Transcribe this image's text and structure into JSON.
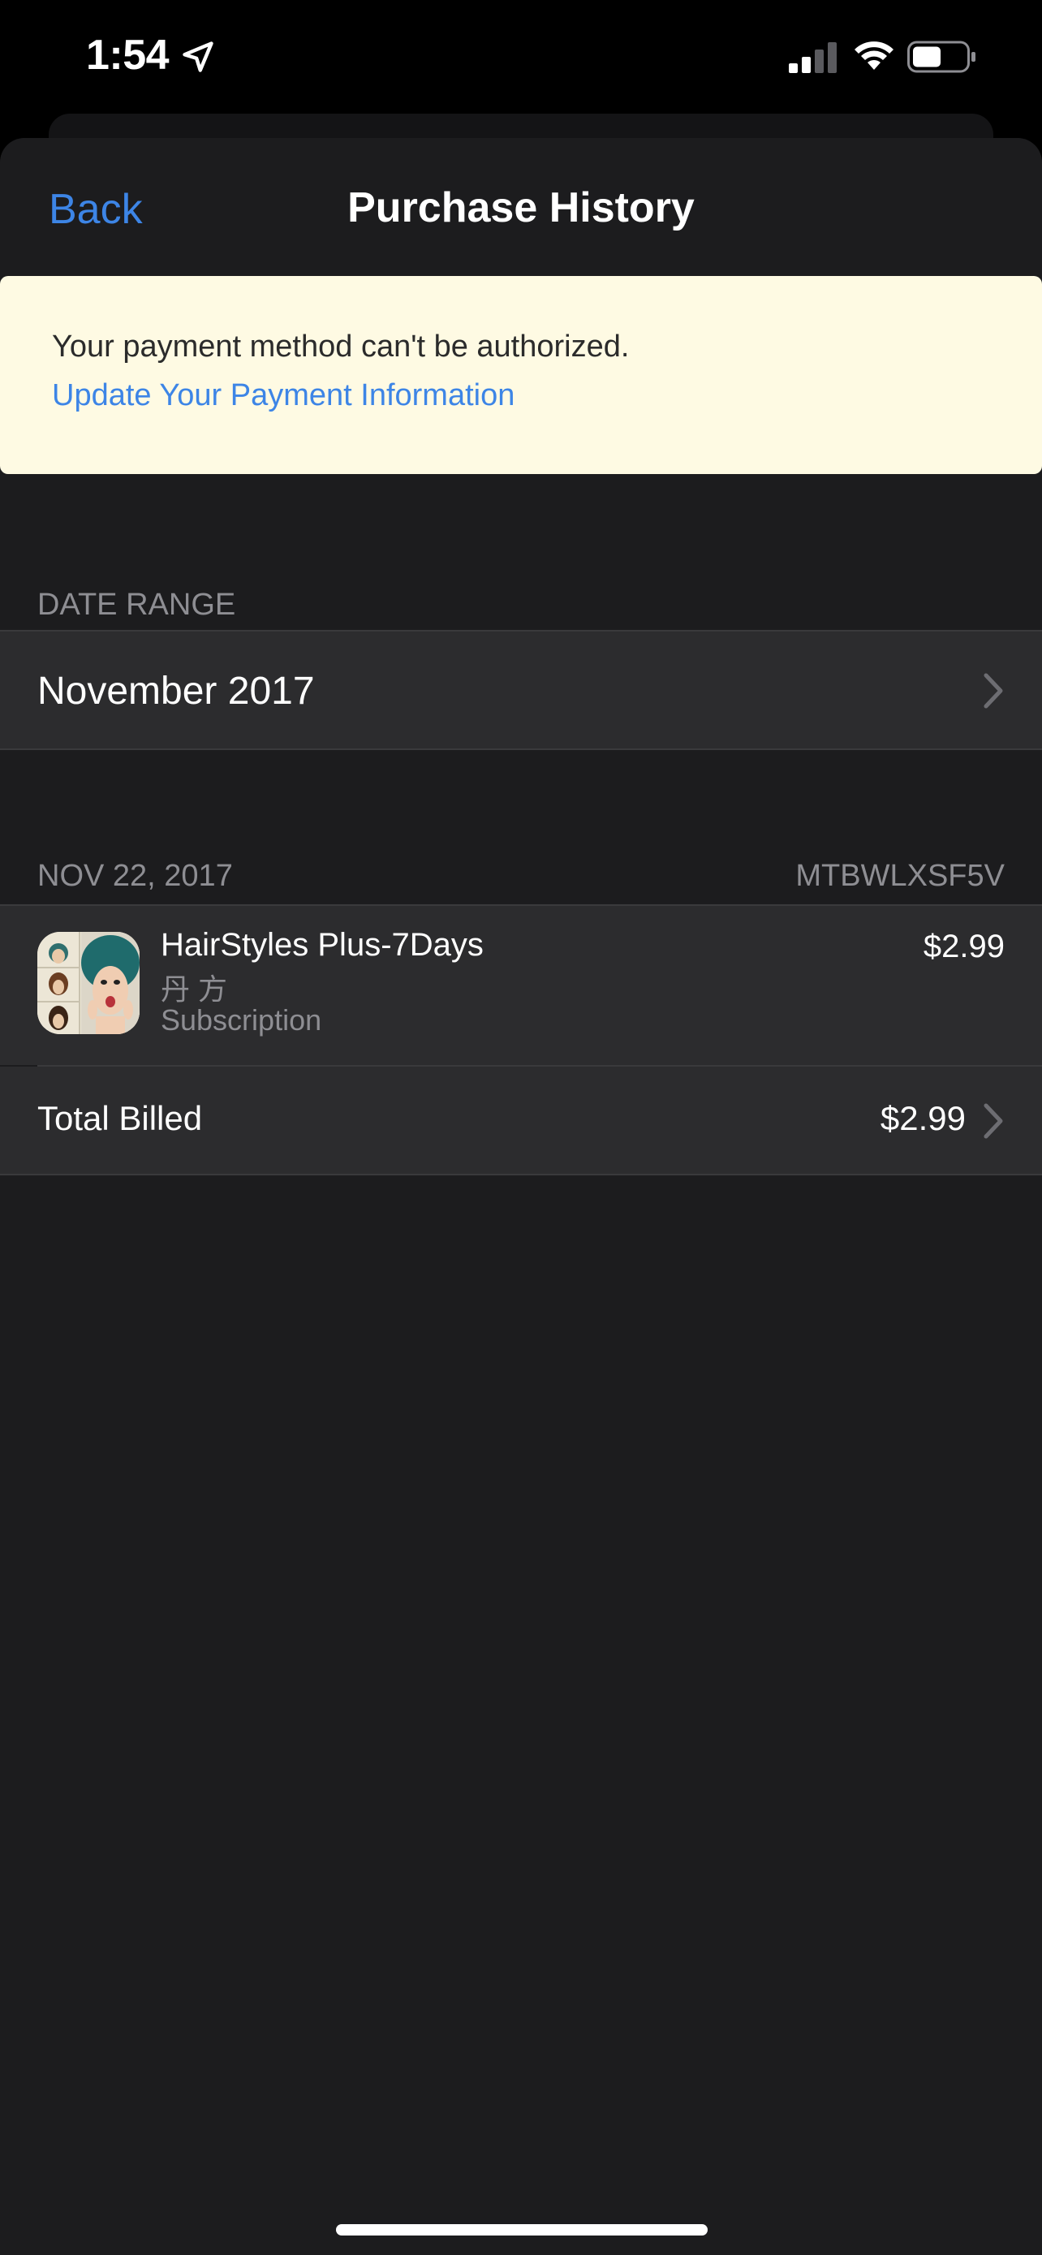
{
  "status_bar": {
    "time": "1:54",
    "icons": [
      "location-arrow-icon",
      "cellular-signal-icon",
      "wifi-icon",
      "battery-icon"
    ]
  },
  "nav": {
    "back_label": "Back",
    "title": "Purchase History"
  },
  "banner": {
    "message": "Your payment method can't be authorized.",
    "link": "Update Your Payment Information"
  },
  "date_range": {
    "header": "DATE RANGE",
    "value": "November 2017"
  },
  "order": {
    "date": "NOV 22, 2017",
    "order_id": "MTBWLXSF5V",
    "item": {
      "name": "HairStyles Plus-7Days",
      "developer": "丹 方",
      "type": "Subscription",
      "price": "$2.99",
      "icon": "hairstyles-app-icon"
    },
    "total_label": "Total Billed",
    "total_value": "$2.99"
  },
  "colors": {
    "background": "#000000",
    "sheet": "#1c1c1e",
    "row": "#2c2c2e",
    "accent": "#3d85e6",
    "banner_bg": "#fefae3",
    "secondary_text": "#8e8e93"
  }
}
